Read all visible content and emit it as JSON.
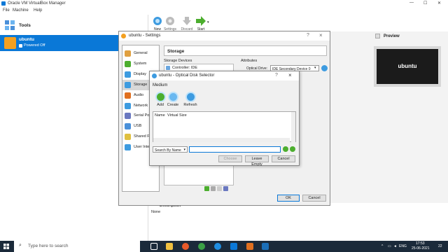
{
  "window": {
    "title": "Oracle VM VirtualBox Manager"
  },
  "menu": [
    "File",
    "Machine",
    "Help"
  ],
  "sidebar": {
    "tools_label": "Tools",
    "vm": {
      "name": "ubuntu",
      "state": "Powered Off"
    }
  },
  "toolbar": [
    {
      "label": "New",
      "icon": "new-icon",
      "enabled": true
    },
    {
      "label": "Settings",
      "icon": "gear-icon",
      "enabled": false
    },
    {
      "label": "Discard",
      "icon": "discard-arrow-icon",
      "enabled": false
    },
    {
      "label": "Start",
      "icon": "start-arrow-icon",
      "enabled": true
    }
  ],
  "preview": {
    "title": "Preview",
    "screen_text": "ubuntu"
  },
  "details": {
    "description_label": "Description",
    "description_value": "None"
  },
  "settings": {
    "title": "ubuntu - Settings",
    "help": "?",
    "close": "×",
    "categories": [
      "General",
      "System",
      "Display",
      "Storage",
      "Audio",
      "Network",
      "Serial Ports",
      "USB",
      "Shared Folders",
      "User Interface"
    ],
    "selected_category": "Storage",
    "section_title": "Storage",
    "devices_label": "Storage Devices",
    "attributes_label": "Attributes",
    "controller": "Controller: IDE",
    "optical_drive_label": "Optical Drive:",
    "optical_drive_value": "IDE Secondary Device 0",
    "ok": "OK",
    "cancel": "Cancel"
  },
  "selector": {
    "title": "ubuntu - Optical Disk Selector",
    "help": "?",
    "close": "×",
    "medium_label": "Medium",
    "buttons": [
      {
        "label": "Add",
        "icon": "add-disk-icon"
      },
      {
        "label": "Create",
        "icon": "create-disk-icon"
      },
      {
        "label": "Refresh",
        "icon": "refresh-icon"
      }
    ],
    "columns": [
      "Name",
      "Virtual Size"
    ],
    "search_mode": "Search By Name",
    "search_value": "",
    "choose": "Choose",
    "leave_empty": "Leave Empty",
    "cancel": "Cancel"
  },
  "taskbar": {
    "search_placeholder": "Type here to search",
    "lang": "ENG",
    "time": "17:53",
    "date": "25-06-2021",
    "notification_count": "22"
  },
  "colors": {
    "accent": "#0a78d7",
    "taskbar": "#1b2a3a"
  }
}
